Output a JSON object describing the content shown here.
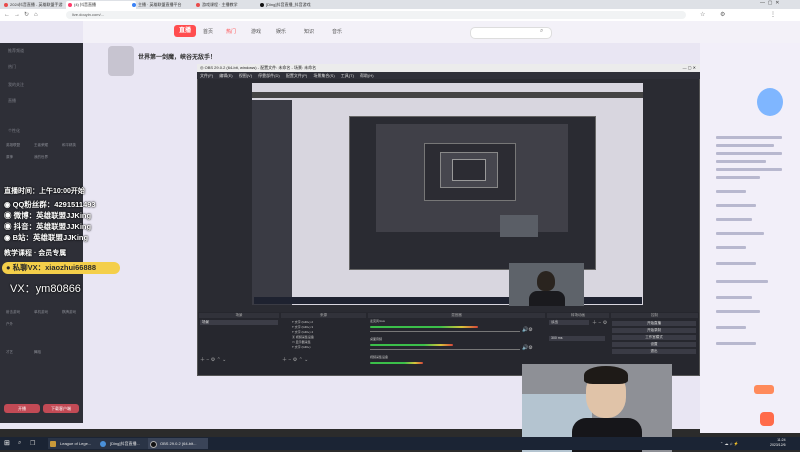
{
  "browser": {
    "tabs": [
      {
        "label": "2024抖音直播 - 英雄联盟手游",
        "color": "#e94b4b"
      },
      {
        "label": "(4) 抖音直播",
        "color": "#ff3c6b"
      },
      {
        "label": "主播 · 英雄联盟直播平台",
        "color": "#3b82f6"
      },
      {
        "label": "游戏课程 · 主播教学",
        "color": "#e94b4b"
      },
      {
        "label": "[Ding]抖音直播_抖音游戏",
        "color": "#111111"
      }
    ],
    "url": "live.douyin.com/..."
  },
  "douyin": {
    "logo_text": "直播",
    "nav": [
      "首页",
      "热门",
      "游戏",
      "娱乐",
      "知识",
      "音乐"
    ],
    "sidebar_items": [
      "推荐频道",
      "热门",
      "我的关注",
      "直播",
      "个性化",
      "英雄联盟",
      "王者荣耀",
      "和平精英",
      "原神",
      "我的世界",
      "射击游戏",
      "单机游戏",
      "棋牌游戏",
      "户外",
      "才艺",
      "舞蹈"
    ],
    "sidebar_buttons": [
      "开播",
      "下载客户端"
    ],
    "banner": "世界第一剑魔，峡谷无敌手！"
  },
  "overlay": {
    "live_time": "直播时间：上午10:00开始",
    "fans_qq": "QQ粉丝群：4291511493",
    "weibo": "微博：英雄联盟JJKing",
    "douyin": "抖音：英雄联盟JJKing",
    "bilibili": "B站：英雄联盟JJKing",
    "course_label": "教学课程 · 会员专属",
    "wechat": "私聊VX：xiaozhui66888",
    "vx": "VX：ym80866"
  },
  "obs": {
    "title": "OBS 29.0.2 (64-bit, windows) - 配置文件: 未命名 - 场景: 未命名",
    "menu": [
      "文件(F)",
      "编辑(E)",
      "视图(V)",
      "停靠部件(D)",
      "配置文件(P)",
      "场景集合(S)",
      "工具(T)",
      "帮助(H)"
    ],
    "docks": {
      "scenes": "场景",
      "sources": "来源",
      "mixer": "混音器",
      "transitions": "转场动画",
      "controls": "控制"
    },
    "scene_name": "场景",
    "sources": [
      "文字 (GDI+) 2",
      "文字 (GDI+) 3",
      "文字 (GDI+) 4",
      "视频采集设备",
      "显示器采集",
      "文字 (GDI+)"
    ],
    "mixer_channels": [
      {
        "name": "麦克风/Aux",
        "level": 0.72
      },
      {
        "name": "桌面音频",
        "level": 0.55
      },
      {
        "name": "视频采集设备",
        "level": 0.35
      }
    ],
    "transition": "淡出",
    "duration": "300 ms",
    "controls": [
      "开始直播",
      "开始录制",
      "工作室模式",
      "设置",
      "退出"
    ]
  },
  "taskbar": {
    "items": [
      {
        "label": "League of Lege...",
        "color": "#c99a3a"
      },
      {
        "label": "[Ding]抖音直播...",
        "color": "#4a90d9"
      },
      {
        "label": "OBS 29.0.2 (64-bit...",
        "color": "#222222"
      }
    ],
    "time": "11:24",
    "date": "2023/12/6"
  }
}
